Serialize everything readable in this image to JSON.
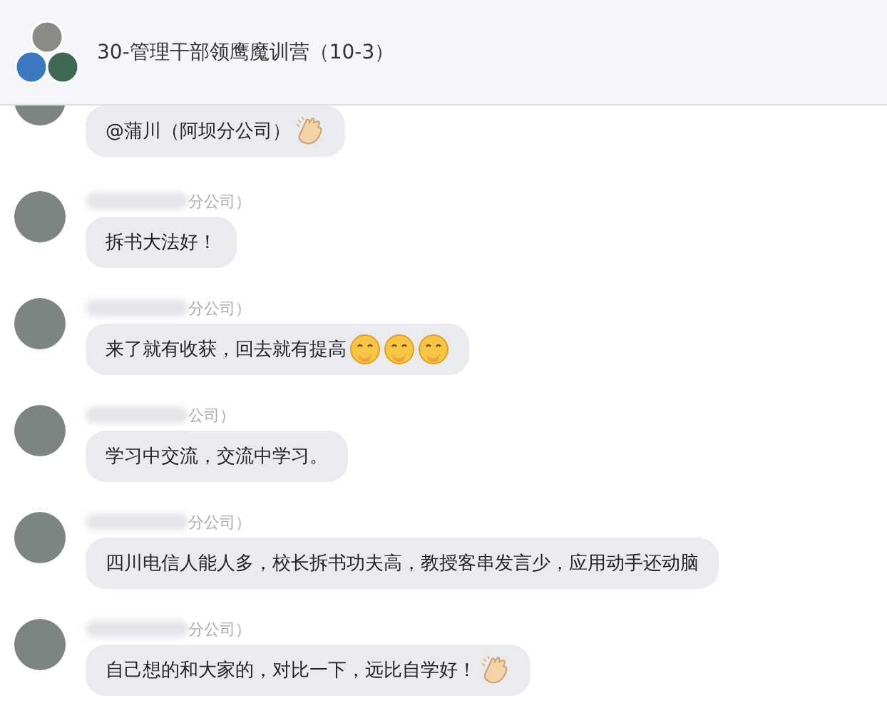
{
  "header": {
    "title": "30-管理干部领鹰魔训营（10-3）"
  },
  "messages": [
    {
      "text": "@蒲川（阿坝分公司）",
      "icons": [
        {
          "kind": "clap"
        }
      ]
    },
    {
      "sender": "分公司）",
      "text": "拆书大法好！"
    },
    {
      "sender": "分公司）",
      "text": "来了就有收获，回去就有提高",
      "icons": [
        {
          "kind": "smile"
        },
        {
          "kind": "smile"
        },
        {
          "kind": "smile"
        }
      ]
    },
    {
      "sender": "公司）",
      "text": "学习中交流，交流中学习。"
    },
    {
      "sender": "分公司）",
      "text": "四川电信人能人多，校长拆书功夫高，教授客串发言少，应用动手还动脑"
    },
    {
      "sender": "分公司）",
      "text": "自己想的和大家的，对比一下，远比自学好！",
      "icons": [
        {
          "kind": "clap"
        }
      ]
    }
  ]
}
